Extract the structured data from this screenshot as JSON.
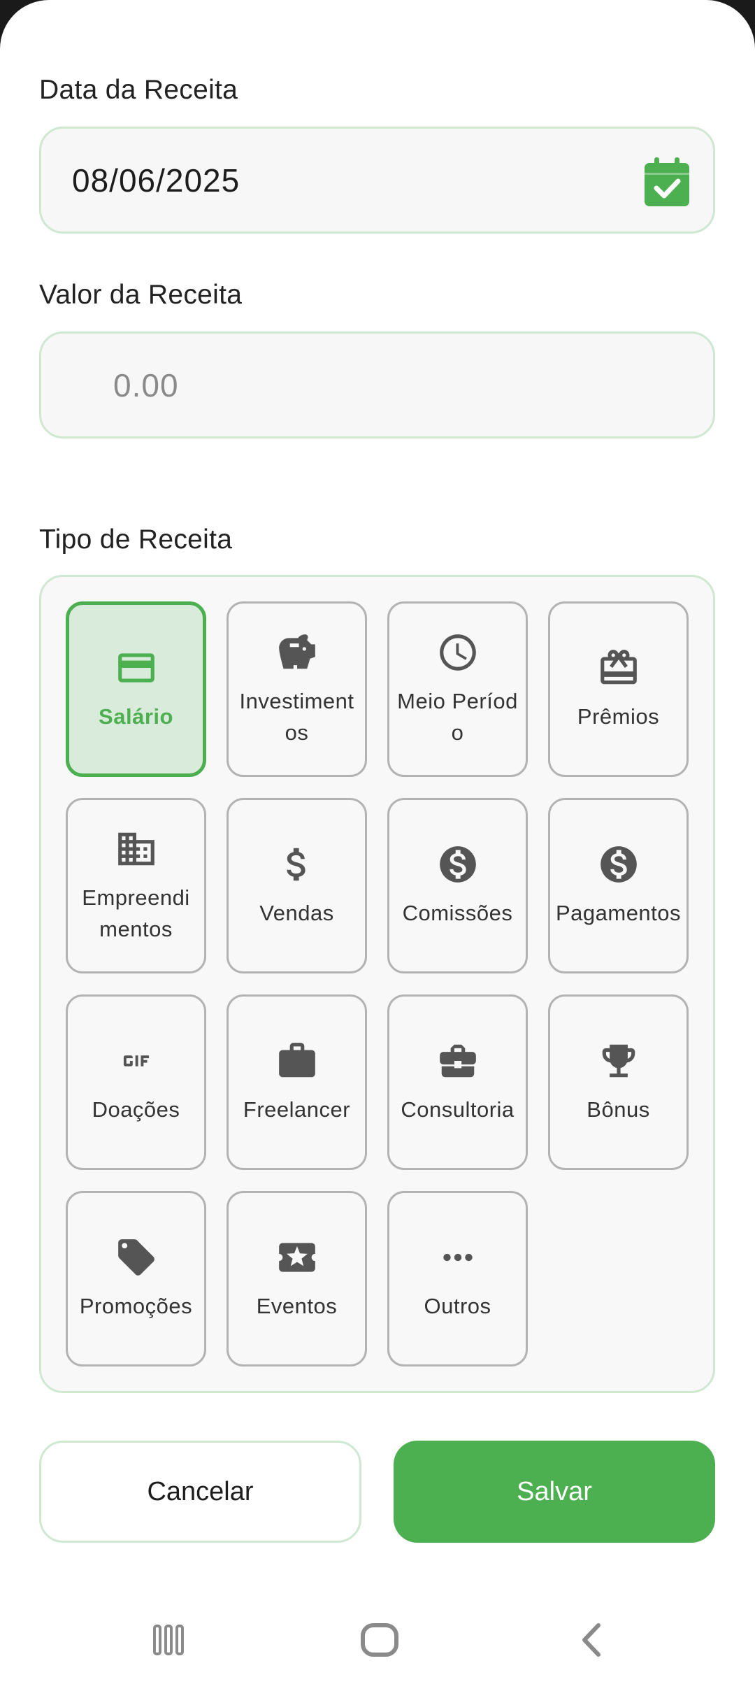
{
  "form": {
    "date_label": "Data da Receita",
    "date_value": "08/06/2025",
    "amount_label": "Valor da Receita",
    "amount_placeholder": "0.00",
    "type_label": "Tipo de Receita"
  },
  "categories": [
    {
      "label": "Salário",
      "icon": "credit-card-icon",
      "selected": true
    },
    {
      "label": "Investimentos",
      "icon": "piggy-bank-icon",
      "selected": false
    },
    {
      "label": "Meio Período",
      "icon": "clock-icon",
      "selected": false
    },
    {
      "label": "Prêmios",
      "icon": "gift-card-icon",
      "selected": false
    },
    {
      "label": "Empreendimentos",
      "icon": "building-icon",
      "selected": false
    },
    {
      "label": "Vendas",
      "icon": "dollar-sign-icon",
      "selected": false
    },
    {
      "label": "Comissões",
      "icon": "dollar-circle-icon",
      "selected": false
    },
    {
      "label": "Pagamentos",
      "icon": "dollar-circle-icon",
      "selected": false
    },
    {
      "label": "Doações",
      "icon": "gif-icon",
      "selected": false
    },
    {
      "label": "Freelancer",
      "icon": "briefcase-icon",
      "selected": false
    },
    {
      "label": "Consultoria",
      "icon": "business-center-icon",
      "selected": false
    },
    {
      "label": "Bônus",
      "icon": "trophy-icon",
      "selected": false
    },
    {
      "label": "Promoções",
      "icon": "tag-icon",
      "selected": false
    },
    {
      "label": "Eventos",
      "icon": "ticket-star-icon",
      "selected": false
    },
    {
      "label": "Outros",
      "icon": "more-horiz-icon",
      "selected": false
    }
  ],
  "actions": {
    "cancel_label": "Cancelar",
    "save_label": "Salvar"
  },
  "colors": {
    "accent": "#4caf50",
    "selected_bg": "#d9ecdb",
    "icon_gray": "#555555"
  }
}
